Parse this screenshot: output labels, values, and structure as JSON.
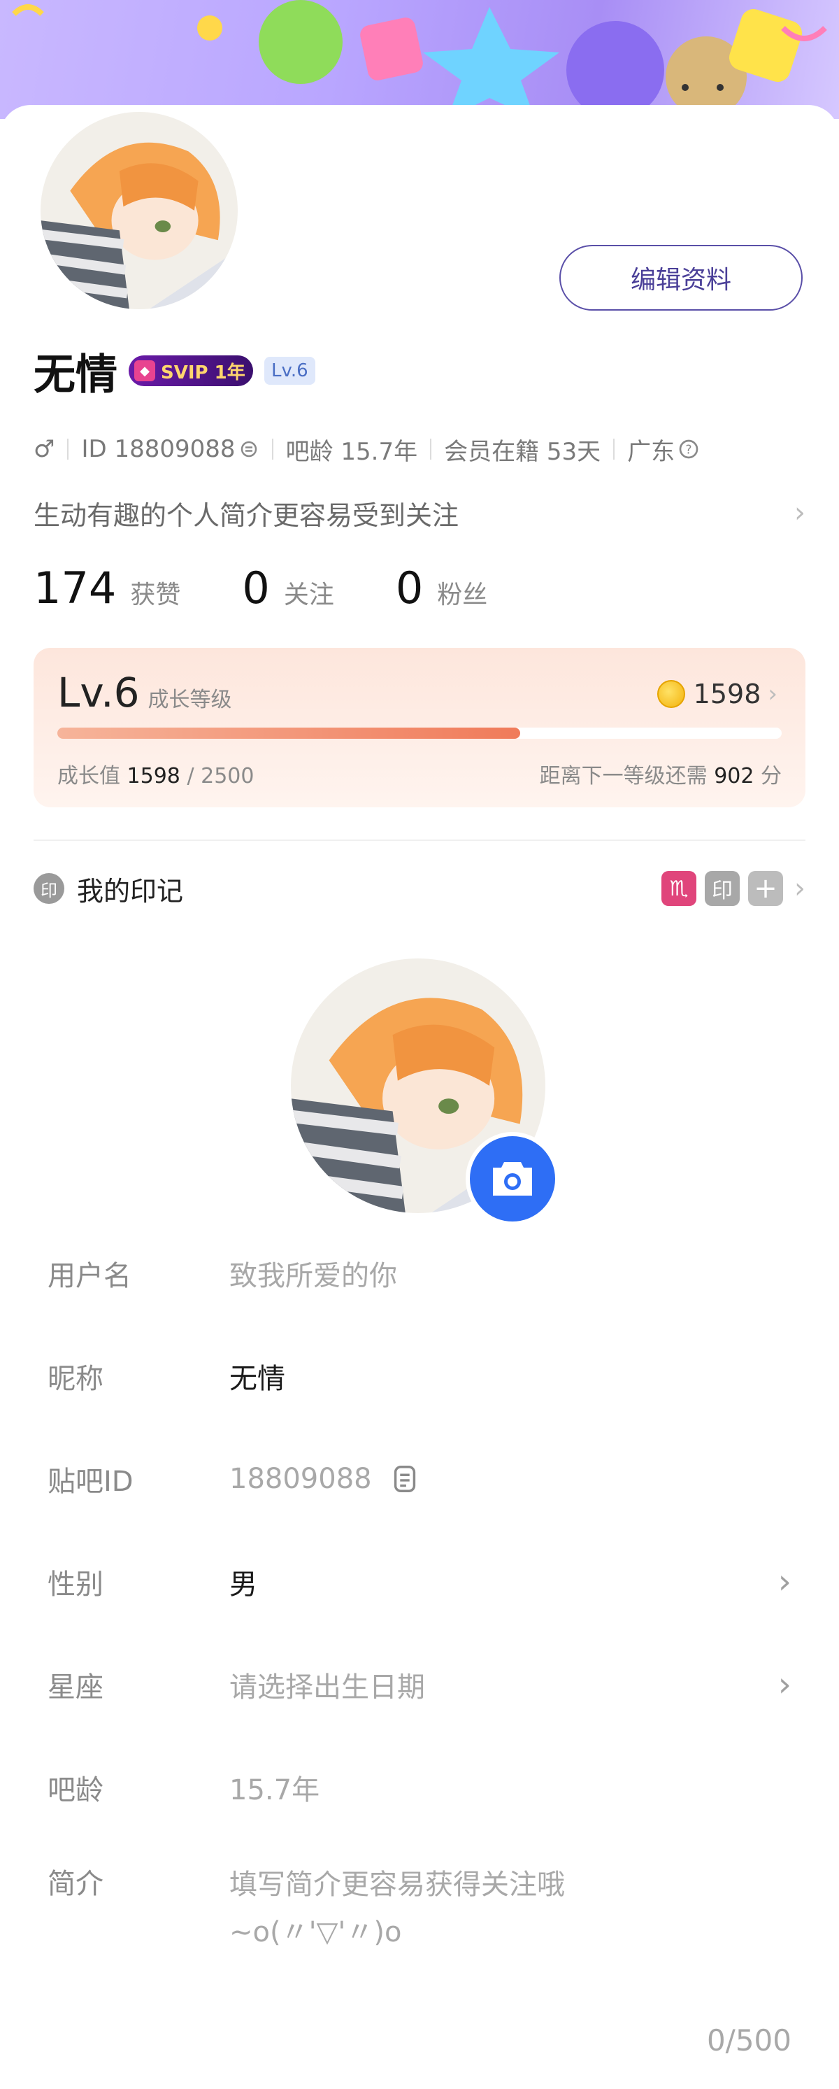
{
  "profile": {
    "name": "无情",
    "svip_badge": "SVIP 1年",
    "level_chip": "Lv.6",
    "edit_button": "编辑资料",
    "gender_symbol": "♂",
    "id_text": "ID 18809088",
    "tieba_age_text": "吧龄 15.7年",
    "member_text": "会员在籍 53天",
    "region_text": "广东",
    "bio_prompt": "生动有趣的个人简介更容易受到关注"
  },
  "stats": [
    {
      "value": "174",
      "label": "获赞"
    },
    {
      "value": "0",
      "label": "关注"
    },
    {
      "value": "0",
      "label": "粉丝"
    }
  ],
  "level_card": {
    "level": "Lv.6",
    "level_label": "成长等级",
    "coins": "1598",
    "growth_label": "成长值",
    "growth_value": "1598",
    "growth_sep": "/",
    "growth_max": "2500",
    "progress_fraction": 0.6392,
    "next_prefix": "距离下一等级还需",
    "next_value": "902",
    "next_unit": "分"
  },
  "marks": {
    "title": "我的印记",
    "title_icon": "印",
    "tags": [
      "♏",
      "印",
      "+"
    ]
  },
  "form": {
    "rows": [
      {
        "key": "用户名",
        "value": "致我所爱的你"
      },
      {
        "key": "昵称",
        "value": "无情"
      },
      {
        "key": "贴吧ID",
        "value": "18809088"
      },
      {
        "key": "性别",
        "value": "男"
      },
      {
        "key": "星座",
        "value": "请选择出生日期"
      },
      {
        "key": "吧龄",
        "value": "15.7年"
      },
      {
        "key": "简介",
        "value": "填写简介更容易获得关注哦",
        "value2": "~o(〃'▽'〃)o"
      }
    ],
    "counter": "0/500"
  },
  "colors": {
    "accent_blue": "#2e6ef5",
    "edit_border": "#5a4fa8",
    "progress": "#f07b5a",
    "svip_bg": "#4a1384"
  }
}
